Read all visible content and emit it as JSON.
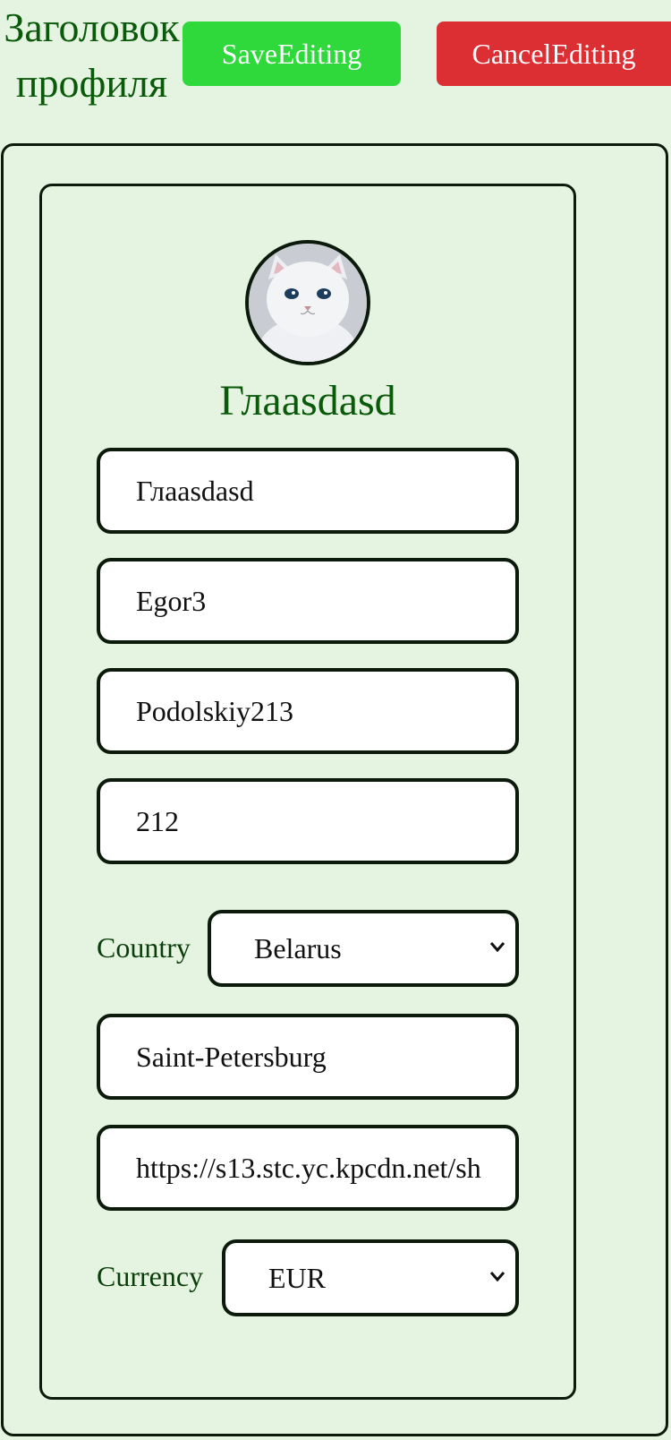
{
  "header": {
    "title": "Заголовок\nпрофиля",
    "save_label": "SaveEditing",
    "cancel_label": "CancelEditing"
  },
  "profile": {
    "display_name": "Глaasdasd",
    "avatar_icon": "cat-avatar"
  },
  "fields": {
    "first_name": "Глaasdasd",
    "nickname": "Egor3",
    "last_name": "Podolskiy213",
    "age": "212",
    "country_label": "Country",
    "country_value": "Belarus",
    "city": "Saint-Petersburg",
    "photo_url": "https://s13.stc.yc.kpcdn.net/sh",
    "currency_label": "Currency",
    "currency_value": "EUR"
  },
  "colors": {
    "background": "#e4f4e1",
    "save": "#2fd93c",
    "cancel": "#db2f33",
    "title": "#0b5a0b"
  }
}
